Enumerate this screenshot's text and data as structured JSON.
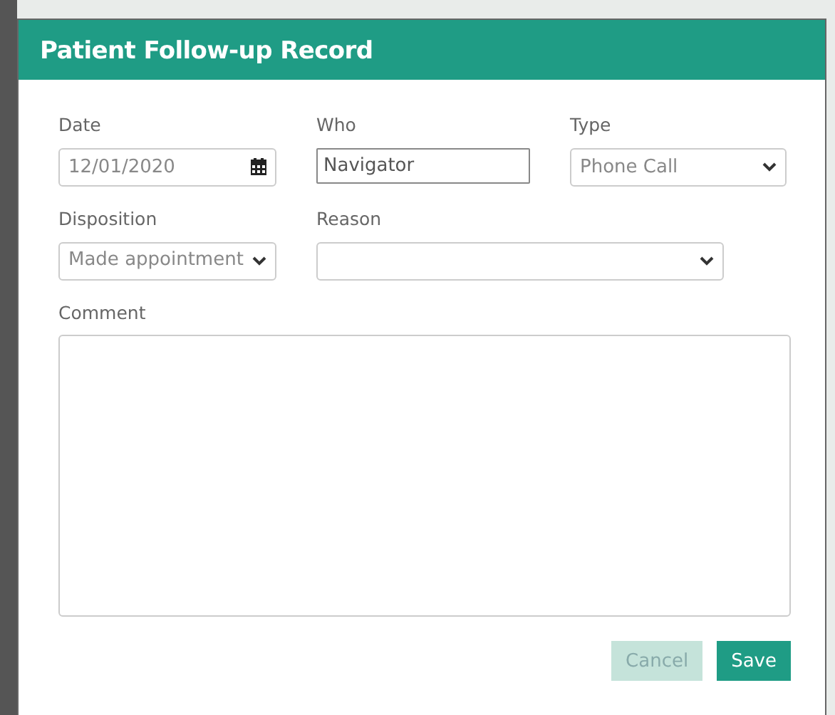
{
  "dialog": {
    "title": "Patient Follow-up Record"
  },
  "fields": [
    {
      "kind": "date",
      "label": "Date",
      "value": "12/01/2020"
    },
    {
      "kind": "text",
      "label": "Who",
      "value": "Navigator"
    },
    {
      "kind": "select",
      "label": "Type",
      "value": "Phone Call"
    },
    {
      "kind": "select",
      "label": "Disposition",
      "value": "Made appointment"
    },
    {
      "kind": "select",
      "label": "Reason"
    },
    {
      "kind": "textarea",
      "label": "Comment"
    }
  ],
  "buttons": [
    {
      "label": "Cancel",
      "kind": "secondary",
      "disabled": true
    },
    {
      "label": "Save",
      "kind": "primary",
      "disabled": false
    }
  ]
}
